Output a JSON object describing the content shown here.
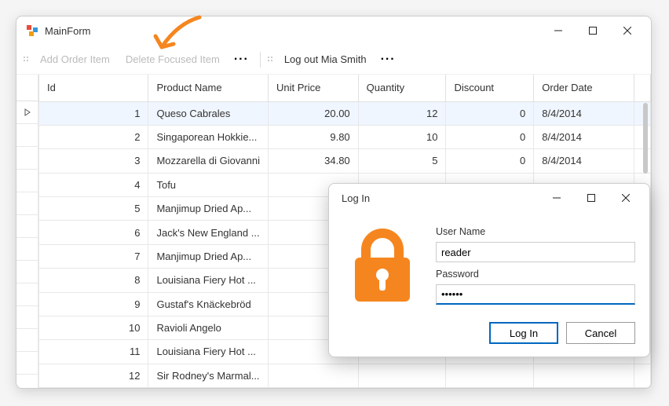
{
  "mainWindow": {
    "title": "MainForm",
    "toolbar": {
      "addOrderItem": "Add Order Item",
      "deleteFocusedItem": "Delete Focused Item",
      "logout": "Log out Mia Smith"
    },
    "columns": {
      "id": "Id",
      "productName": "Product Name",
      "unitPrice": "Unit Price",
      "quantity": "Quantity",
      "discount": "Discount",
      "orderDate": "Order Date"
    },
    "rows": [
      {
        "id": 1,
        "productName": "Queso Cabrales",
        "unitPrice": "20.00",
        "quantity": "12",
        "discount": "0",
        "orderDate": "8/4/2014"
      },
      {
        "id": 2,
        "productName": "Singaporean Hokkie...",
        "unitPrice": "9.80",
        "quantity": "10",
        "discount": "0",
        "orderDate": "8/4/2014"
      },
      {
        "id": 3,
        "productName": "Mozzarella di Giovanni",
        "unitPrice": "34.80",
        "quantity": "5",
        "discount": "0",
        "orderDate": "8/4/2014"
      },
      {
        "id": 4,
        "productName": "Tofu",
        "unitPrice": "",
        "quantity": "",
        "discount": "",
        "orderDate": ""
      },
      {
        "id": 5,
        "productName": "Manjimup Dried Ap...",
        "unitPrice": "",
        "quantity": "",
        "discount": "",
        "orderDate": ""
      },
      {
        "id": 6,
        "productName": "Jack's New England ...",
        "unitPrice": "",
        "quantity": "",
        "discount": "",
        "orderDate": ""
      },
      {
        "id": 7,
        "productName": "Manjimup Dried Ap...",
        "unitPrice": "",
        "quantity": "",
        "discount": "",
        "orderDate": ""
      },
      {
        "id": 8,
        "productName": "Louisiana Fiery Hot ...",
        "unitPrice": "",
        "quantity": "",
        "discount": "",
        "orderDate": ""
      },
      {
        "id": 9,
        "productName": "Gustaf's Knäckebröd",
        "unitPrice": "",
        "quantity": "",
        "discount": "",
        "orderDate": ""
      },
      {
        "id": 10,
        "productName": "Ravioli Angelo",
        "unitPrice": "",
        "quantity": "",
        "discount": "",
        "orderDate": ""
      },
      {
        "id": 11,
        "productName": "Louisiana Fiery Hot ...",
        "unitPrice": "",
        "quantity": "",
        "discount": "",
        "orderDate": ""
      },
      {
        "id": 12,
        "productName": "Sir Rodney's Marmal...",
        "unitPrice": "",
        "quantity": "",
        "discount": "",
        "orderDate": ""
      }
    ]
  },
  "loginDialog": {
    "title": "Log In",
    "userNameLabel": "User Name",
    "userNameValue": "reader",
    "passwordLabel": "Password",
    "passwordValue": "••••••",
    "loginButton": "Log In",
    "cancelButton": "Cancel"
  },
  "annotation": {
    "arrowColor": "#f5861f"
  }
}
